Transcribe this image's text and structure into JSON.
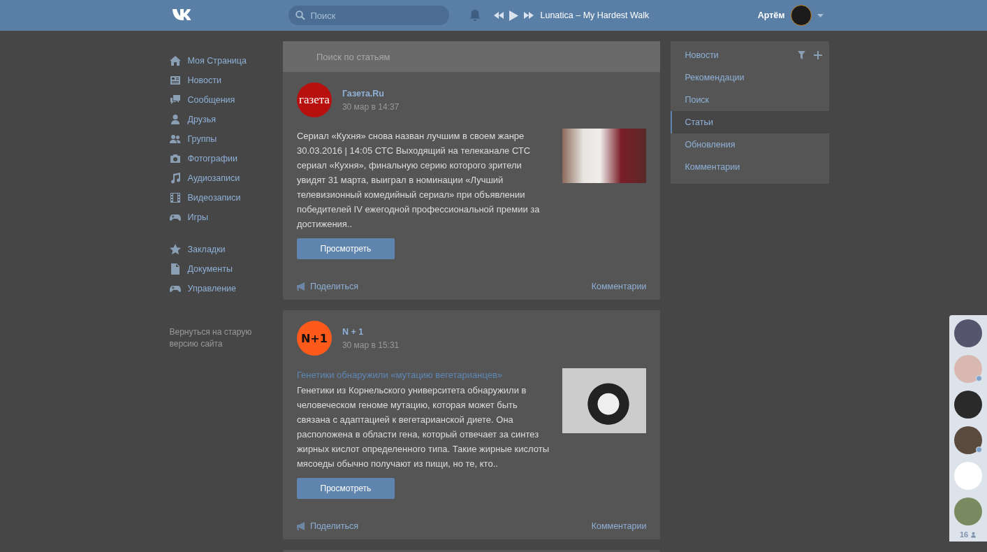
{
  "header": {
    "search": {
      "placeholder": "Поиск"
    },
    "now_playing": "Lunatica – My Hardest Walk",
    "user_name": "Артём"
  },
  "sidebar": {
    "items": [
      {
        "label": "Моя Страница"
      },
      {
        "label": "Новости"
      },
      {
        "label": "Сообщения"
      },
      {
        "label": "Друзья"
      },
      {
        "label": "Группы"
      },
      {
        "label": "Фотографии"
      },
      {
        "label": "Аудиозаписи"
      },
      {
        "label": "Видеозаписи"
      },
      {
        "label": "Игры"
      },
      {
        "label": "Закладки"
      },
      {
        "label": "Документы"
      },
      {
        "label": "Управление"
      }
    ],
    "old_version_link": "Вернуться на старую версию сайта"
  },
  "feed": {
    "search": {
      "placeholder": "Поиск по статьям"
    },
    "posts": [
      {
        "author": "Газета.Ru",
        "logo": {
          "text": "газета",
          "color": "#b8100f"
        },
        "time": "30 мар в 14:37",
        "text": "Сериал «Кухня» снова назван лучшим в своем жанре 30.03.2016 | 14:05 СТС Выходящий на телеканале СТС сериал «Кухня», финальную серию которого зрители увидят 31 марта, выиграл в номинации «Лучший телевизионный комедийный сериал» при объявлении победителей IV ежегодной профессиональной премии за достижения..",
        "button": "Просмотреть",
        "share": "Поделиться",
        "comments": "Комментарии"
      },
      {
        "author": "N + 1",
        "logo": {
          "text": "N+1",
          "color": "#ff5a1a"
        },
        "time": "30 мар в 15:31",
        "title": "Генетики обнаружили «мутацию вегетарианцев»",
        "text": "Генетики из Корнельского университета обнаружили в человеческом геноме мутацию, которая может быть связана с адаптацией к вегетарианской диете. Она расположена в области гена, который отвечает за синтез жирных кислот определенного типа. Такие жирные кислоты мясоеды обычно получают из пищи, но те, кто..",
        "button": "Просмотреть",
        "share": "Поделиться",
        "comments": "Комментарии"
      }
    ]
  },
  "right_menu": {
    "items": [
      {
        "label": "Новости",
        "selected": false
      },
      {
        "label": "Рекомендации",
        "selected": false
      },
      {
        "label": "Поиск",
        "selected": false
      },
      {
        "label": "Статьи",
        "selected": true
      },
      {
        "label": "Обновления",
        "selected": false
      },
      {
        "label": "Комментарии",
        "selected": false
      }
    ]
  },
  "chat_bar": {
    "friends": [
      {
        "online": false
      },
      {
        "online": true
      },
      {
        "online": false
      },
      {
        "online": true
      },
      {
        "online": false
      },
      {
        "online": false
      }
    ],
    "count": "16"
  }
}
